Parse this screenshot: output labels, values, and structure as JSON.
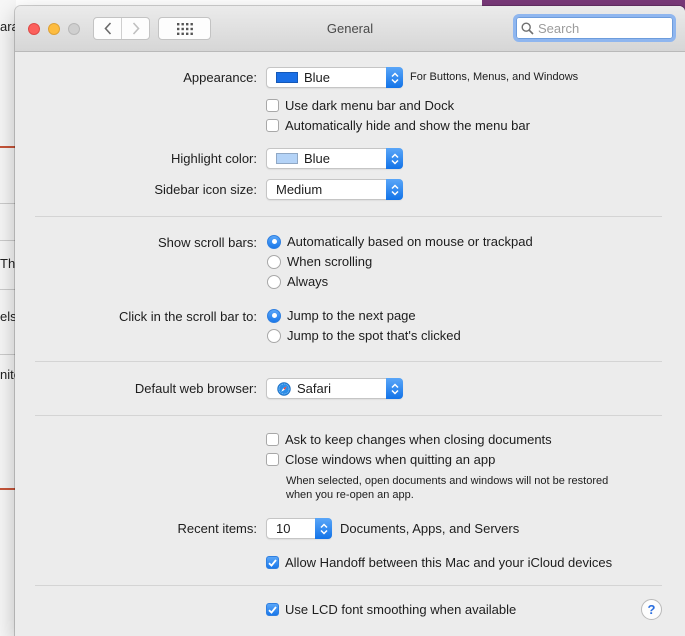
{
  "background": {
    "fragments": [
      "ara",
      "Th",
      "els",
      "nite"
    ]
  },
  "window": {
    "title": "General",
    "search_placeholder": "Search"
  },
  "appearance": {
    "label": "Appearance:",
    "value": "Blue",
    "swatch_color": "#1a6fe6",
    "aside": "For Buttons, Menus, and Windows",
    "dark_menu": "Use dark menu bar and Dock",
    "auto_hide": "Automatically hide and show the menu bar"
  },
  "highlight": {
    "label": "Highlight color:",
    "value": "Blue",
    "swatch_color": "#b4d3f7"
  },
  "sidebar_icon": {
    "label": "Sidebar icon size:",
    "value": "Medium"
  },
  "scroll_bars": {
    "label": "Show scroll bars:",
    "options": [
      "Automatically based on mouse or trackpad",
      "When scrolling",
      "Always"
    ],
    "selected": 0
  },
  "click_scroll": {
    "label": "Click in the scroll bar to:",
    "options": [
      "Jump to the next page",
      "Jump to the spot that's clicked"
    ],
    "selected": 0
  },
  "browser": {
    "label": "Default web browser:",
    "value": "Safari"
  },
  "documents": {
    "ask_keep": "Ask to keep changes when closing documents",
    "close_windows": "Close windows when quitting an app",
    "note_line1": "When selected, open documents and windows will not be restored",
    "note_line2": "when you re-open an app."
  },
  "recent": {
    "label": "Recent items:",
    "value": "10",
    "aside": "Documents, Apps, and Servers"
  },
  "handoff": {
    "label": "Allow Handoff between this Mac and your iCloud devices",
    "checked": true
  },
  "lcd": {
    "label": "Use LCD font smoothing when available",
    "checked": true
  },
  "help_glyph": "?"
}
